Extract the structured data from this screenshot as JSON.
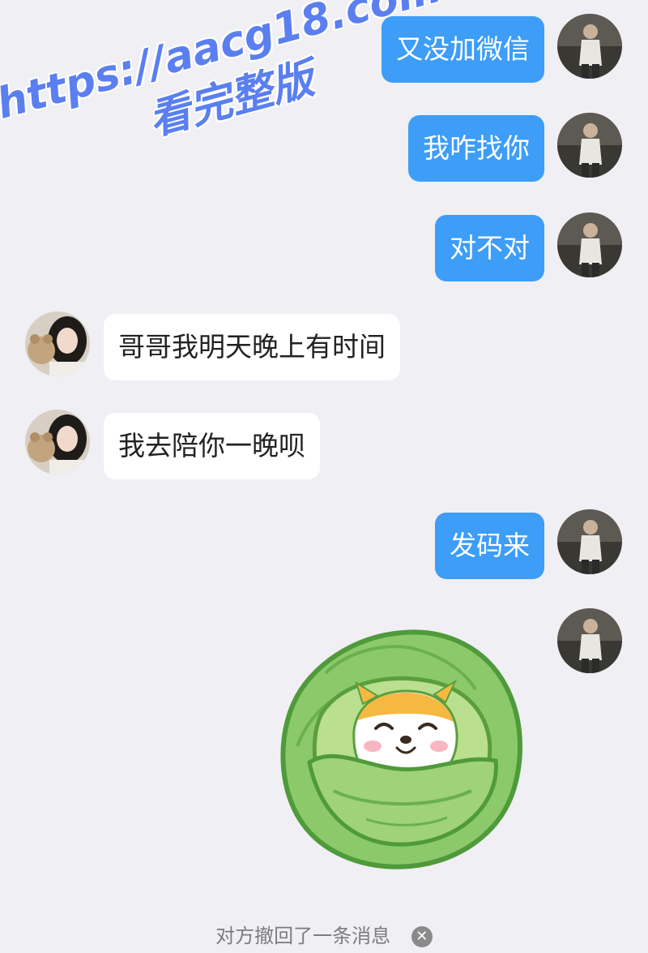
{
  "watermark": {
    "url": "https://aacg18.com",
    "subtitle": "看完整版"
  },
  "messages": [
    {
      "side": "right",
      "text": "又没加微信"
    },
    {
      "side": "right",
      "text": "我咋找你"
    },
    {
      "side": "right",
      "text": "对不对"
    },
    {
      "side": "left",
      "text": "哥哥我明天晚上有时间"
    },
    {
      "side": "left",
      "text": "我去陪你一晚呗"
    },
    {
      "side": "right",
      "text": "发码来"
    },
    {
      "side": "right",
      "sticker": "cabbage-shiba-sticker"
    }
  ],
  "recall_notice": {
    "text": "对方撤回了一条消息",
    "close_icon": "close-icon"
  },
  "colors": {
    "outgoing_bubble": "#3d9df7",
    "incoming_bubble": "#ffffff",
    "background": "#efeff4",
    "watermark": "#5b7ff0"
  }
}
